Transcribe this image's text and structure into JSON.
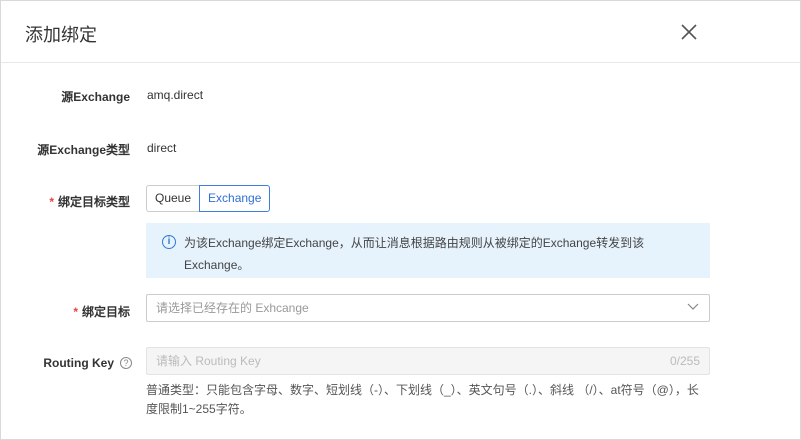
{
  "dialog": {
    "title": "添加绑定"
  },
  "fields": {
    "source_exchange": {
      "label": "源Exchange",
      "value": "amq.direct"
    },
    "source_type": {
      "label": "源Exchange类型",
      "value": "direct"
    },
    "target_type": {
      "required": "*",
      "label": "绑定目标类型",
      "options": [
        "Queue",
        "Exchange"
      ],
      "selected": "Exchange"
    },
    "info": "为该Exchange绑定Exchange，从而让消息根据路由规则从被绑定的Exchange转发到该Exchange。",
    "target": {
      "required": "*",
      "label": "绑定目标",
      "placeholder": "请选择已经存在的 Exhcange"
    },
    "routing_key": {
      "label": "Routing Key",
      "help_icon": "?",
      "placeholder": "请输入 Routing Key",
      "counter": "0/255",
      "help": "普通类型：只能包含字母、数字、短划线（-）、下划线（_）、英文句号（.）、斜线 （/）、at符号（@），长度限制1~255字符。"
    }
  },
  "colors": {
    "accent": "#2f6fd6",
    "required": "#e54545",
    "info_bg": "#e6f2fc"
  }
}
